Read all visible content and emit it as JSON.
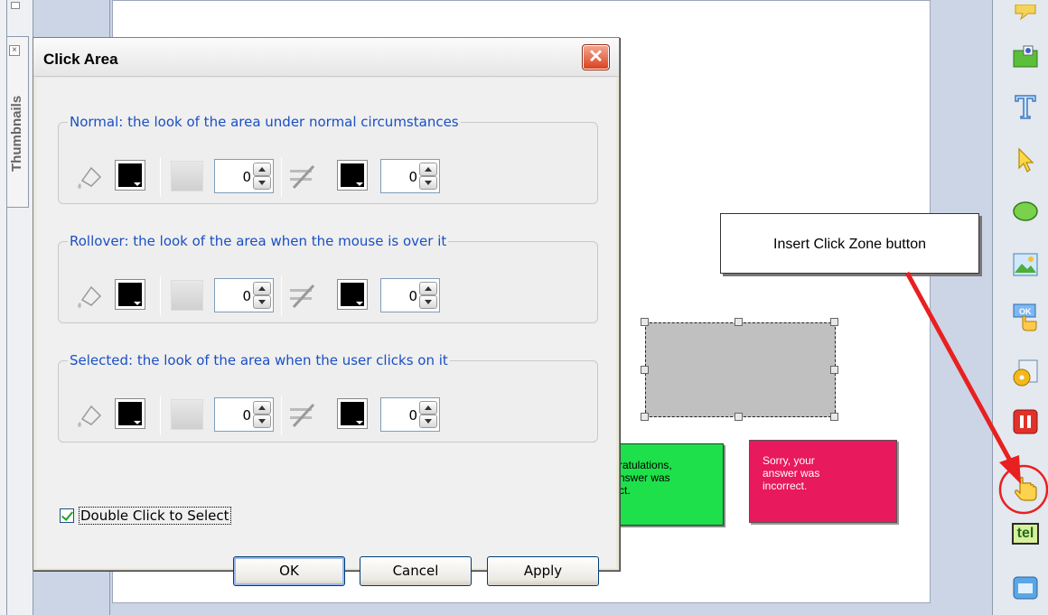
{
  "left_panel": {
    "thumbnails_label": "Thumbnails"
  },
  "slide": {
    "correct_feedback": "ratulations,\nnswer was\nct.",
    "incorrect_feedback": "Sorry, your\nanswer was\nincorrect."
  },
  "callout": {
    "text": "Insert Click Zone button"
  },
  "dialog": {
    "title": "Click Area",
    "groups": [
      {
        "legend": "Normal: the look of the area under normal circumstances",
        "fill_color": "#000000",
        "transparency": "0",
        "line_color": "#000000",
        "line_width": "0"
      },
      {
        "legend": "Rollover: the look of the area when the mouse is over it",
        "fill_color": "#000000",
        "transparency": "0",
        "line_color": "#000000",
        "line_width": "0"
      },
      {
        "legend": "Selected: the look of the area when the user clicks on it",
        "fill_color": "#000000",
        "transparency": "0",
        "line_color": "#000000",
        "line_width": "0"
      }
    ],
    "double_click_label": "Double Click to Select",
    "double_click_checked": true,
    "buttons": {
      "ok": "OK",
      "cancel": "Cancel",
      "apply": "Apply"
    }
  },
  "toolbar": {
    "tools": [
      "caption-icon",
      "highlight-icon",
      "text-icon",
      "pointer-icon",
      "shape-icon",
      "image-icon",
      "button-icon",
      "animation-icon",
      "pause-icon",
      "click-zone-icon",
      "text-entry-icon",
      "window-icon"
    ],
    "text_entry_label": "tel"
  },
  "colors": {
    "accent_red": "#e82020",
    "legend_blue": "#1a4fc4",
    "correct_green": "#1ee04a",
    "incorrect_pink": "#e8195c"
  }
}
